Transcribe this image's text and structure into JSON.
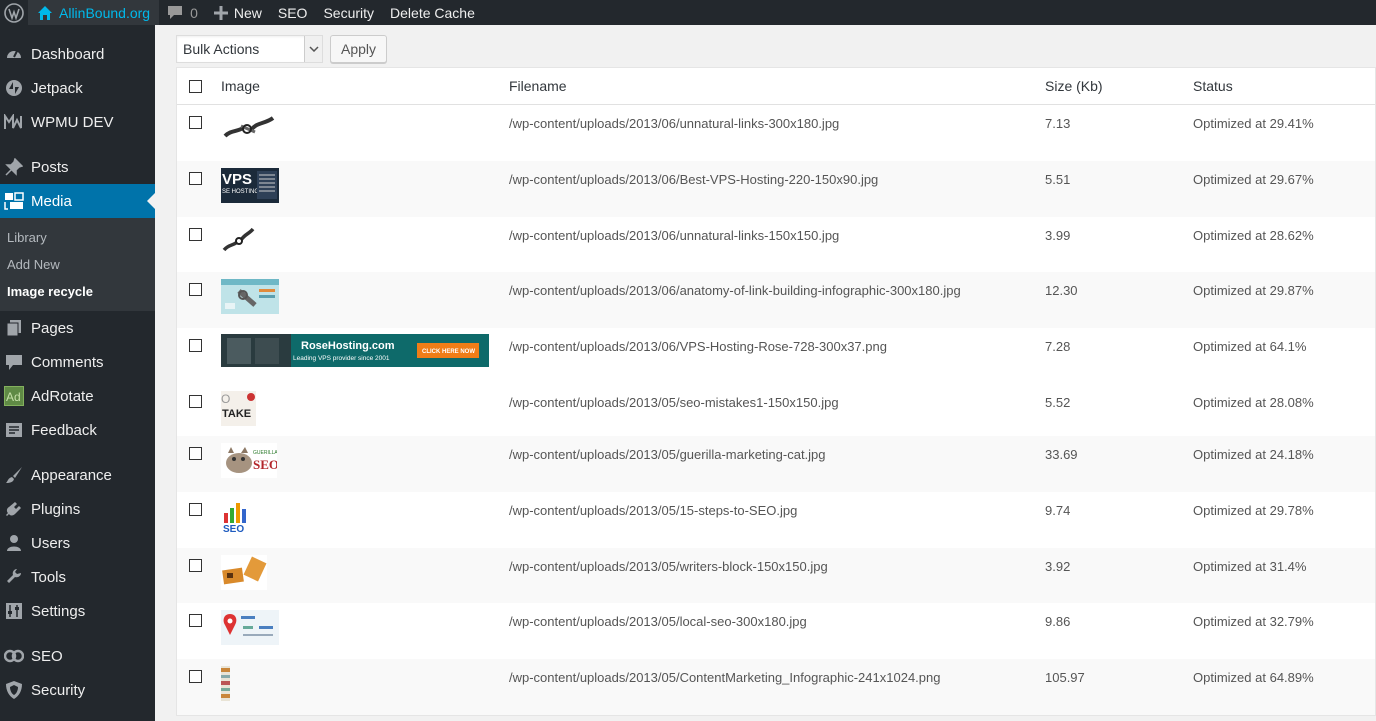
{
  "adminbar": {
    "site_name": "AllinBound.org",
    "comments_count": "0",
    "new_label": "New",
    "seo_label": "SEO",
    "security_label": "Security",
    "delete_cache_label": "Delete Cache"
  },
  "sidebar": {
    "items_top": [
      {
        "label": "Dashboard",
        "icon": "dashboard-icon"
      },
      {
        "label": "Jetpack",
        "icon": "jetpack-icon"
      },
      {
        "label": "WPMU DEV",
        "icon": "wpmudev-icon"
      }
    ],
    "items_mid": [
      {
        "label": "Posts",
        "icon": "pin-icon"
      }
    ],
    "media_label": "Media",
    "submenu": [
      {
        "label": "Library"
      },
      {
        "label": "Add New"
      },
      {
        "label": "Image recycle"
      }
    ],
    "items_after_media": [
      {
        "label": "Pages",
        "icon": "pages-icon"
      },
      {
        "label": "Comments",
        "icon": "comments-icon"
      },
      {
        "label": "AdRotate",
        "icon": "adrotate-icon"
      },
      {
        "label": "Feedback",
        "icon": "feedback-icon"
      }
    ],
    "items_tools": [
      {
        "label": "Appearance",
        "icon": "brush-icon"
      },
      {
        "label": "Plugins",
        "icon": "plugin-icon"
      },
      {
        "label": "Users",
        "icon": "user-icon"
      },
      {
        "label": "Tools",
        "icon": "wrench-icon"
      },
      {
        "label": "Settings",
        "icon": "settings-icon"
      }
    ],
    "items_bottom": [
      {
        "label": "SEO",
        "icon": "seo-icon"
      },
      {
        "label": "Security",
        "icon": "shield-icon"
      }
    ]
  },
  "toolbar": {
    "bulk_actions": "Bulk Actions",
    "apply_label": "Apply"
  },
  "table": {
    "columns": [
      "Image",
      "Filename",
      "Size (Kb)",
      "Status"
    ],
    "rows": [
      {
        "filename": "/wp-content/uploads/2013/06/unnatural-links-300x180.jpg",
        "size": "7.13",
        "status": "Optimized at 29.41%",
        "thumb": "chain"
      },
      {
        "filename": "/wp-content/uploads/2013/06/Best-VPS-Hosting-220-150x90.jpg",
        "size": "5.51",
        "status": "Optimized at 29.67%",
        "thumb": "vps"
      },
      {
        "filename": "/wp-content/uploads/2013/06/unnatural-links-150x150.jpg",
        "size": "3.99",
        "status": "Optimized at 28.62%",
        "thumb": "chain-small"
      },
      {
        "filename": "/wp-content/uploads/2013/06/anatomy-of-link-building-infographic-300x180.jpg",
        "size": "12.30",
        "status": "Optimized at 29.87%",
        "thumb": "anatomy"
      },
      {
        "filename": "/wp-content/uploads/2013/06/VPS-Hosting-Rose-728-300x37.png",
        "size": "7.28",
        "status": "Optimized at 64.1%",
        "thumb": "rosehosting"
      },
      {
        "filename": "/wp-content/uploads/2013/05/seo-mistakes1-150x150.jpg",
        "size": "5.52",
        "status": "Optimized at 28.08%",
        "thumb": "mistakes"
      },
      {
        "filename": "/wp-content/uploads/2013/05/guerilla-marketing-cat.jpg",
        "size": "33.69",
        "status": "Optimized at 24.18%",
        "thumb": "cat"
      },
      {
        "filename": "/wp-content/uploads/2013/05/15-steps-to-SEO.jpg",
        "size": "9.74",
        "status": "Optimized at 29.78%",
        "thumb": "steps"
      },
      {
        "filename": "/wp-content/uploads/2013/05/writers-block-150x150.jpg",
        "size": "3.92",
        "status": "Optimized at 31.4%",
        "thumb": "blocks"
      },
      {
        "filename": "/wp-content/uploads/2013/05/local-seo-300x180.jpg",
        "size": "9.86",
        "status": "Optimized at 32.79%",
        "thumb": "localseo"
      },
      {
        "filename": "/wp-content/uploads/2013/05/ContentMarketing_Infographic-241x1024.png",
        "size": "105.97",
        "status": "Optimized at 64.89%",
        "thumb": "infographic"
      }
    ]
  },
  "thumb_text": {
    "vps": "VPS",
    "vps_sub": "SE HOSTING",
    "rose_title": "RoseHosting.com",
    "rose_sub": "Leading VPS provider since 2001",
    "rose_btn": "CLICK HERE NOW",
    "mistakes": "TAKE",
    "cat_seo": "SEO",
    "steps_seo": "SEO"
  },
  "colors": {
    "adminbar_bg": "#23282d",
    "accent": "#0073aa",
    "site_link": "#00b9eb"
  }
}
